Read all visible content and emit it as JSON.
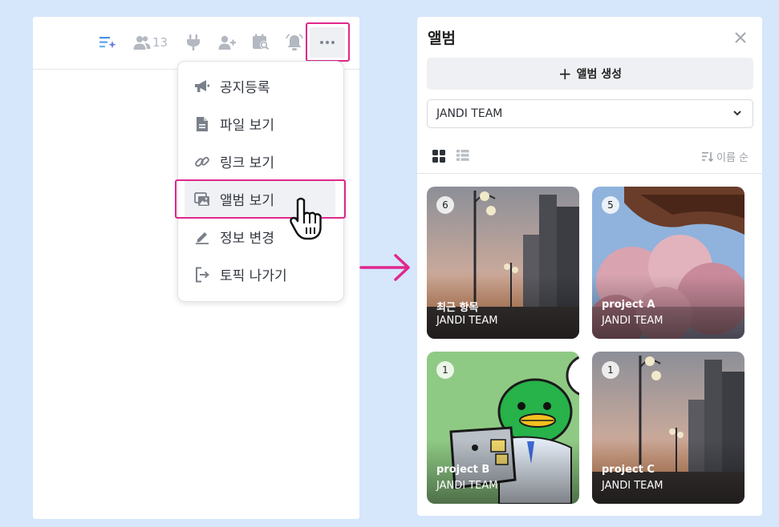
{
  "left": {
    "topbar": {
      "member_count": "13",
      "icons": [
        "ai-list-icon",
        "members-icon",
        "plug-icon",
        "add-member-icon",
        "calendar-search-icon",
        "bell-icon",
        "more-icon"
      ]
    },
    "menu": {
      "items": [
        {
          "label": "공지등록",
          "icon": "megaphone-icon"
        },
        {
          "label": "파일 보기",
          "icon": "file-icon"
        },
        {
          "label": "링크 보기",
          "icon": "link-icon"
        },
        {
          "label": "앨범 보기",
          "icon": "album-icon"
        },
        {
          "label": "정보 변경",
          "icon": "pencil-icon"
        },
        {
          "label": "토픽 나가기",
          "icon": "exit-icon"
        }
      ],
      "active_index": 3
    }
  },
  "right": {
    "title": "앨범",
    "create_label": "앨범 생성",
    "team_select": "JANDI TEAM",
    "sort_label": "이름 순",
    "albums": [
      {
        "count": "6",
        "name": "최근 항목",
        "team": "JANDI TEAM",
        "theme": "street"
      },
      {
        "count": "5",
        "name": "project A",
        "team": "JANDI TEAM",
        "theme": "blossom"
      },
      {
        "count": "1",
        "name": "project B",
        "team": "JANDI TEAM",
        "theme": "character"
      },
      {
        "count": "1",
        "name": "project C",
        "team": "JANDI TEAM",
        "theme": "street"
      }
    ]
  },
  "colors": {
    "highlight": "#e0278c",
    "background": "#d6e6fb"
  }
}
